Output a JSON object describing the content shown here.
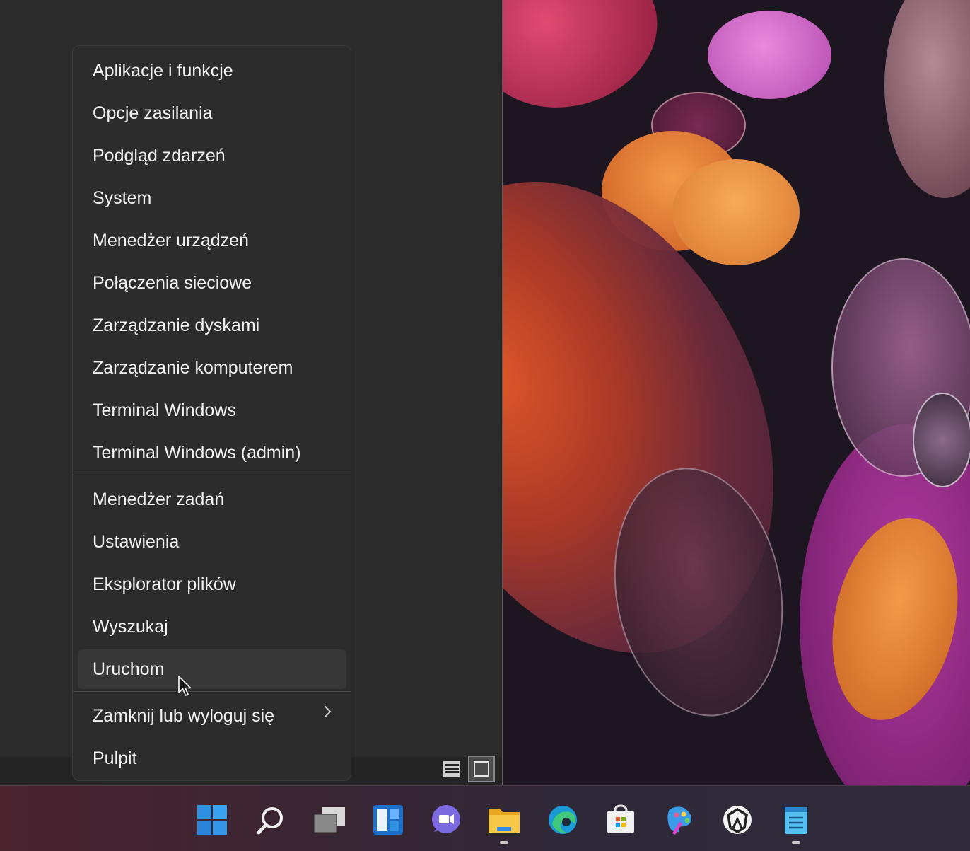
{
  "context_menu": {
    "items": [
      {
        "label": "Aplikacje i funkcje"
      },
      {
        "label": "Opcje zasilania"
      },
      {
        "label": "Podgląd zdarzeń"
      },
      {
        "label": "System"
      },
      {
        "label": "Menedżer urządzeń"
      },
      {
        "label": "Połączenia sieciowe"
      },
      {
        "label": "Zarządzanie dyskami"
      },
      {
        "label": "Zarządzanie komputerem"
      },
      {
        "label": "Terminal Windows"
      },
      {
        "label": "Terminal Windows (admin)"
      },
      {
        "label": "Menedżer zadań"
      },
      {
        "label": "Ustawienia"
      },
      {
        "label": "Eksplorator plików"
      },
      {
        "label": "Wyszukaj"
      },
      {
        "label": "Uruchom",
        "hovered": true
      },
      {
        "label": "Zamknij lub wyloguj się",
        "has_submenu": true
      },
      {
        "label": "Pulpit"
      }
    ]
  },
  "view_toggle": {
    "list_icon": "details-view-icon",
    "tile_icon": "tiles-view-icon",
    "selected": "tiles"
  },
  "taskbar": {
    "icons": [
      {
        "name": "start-icon"
      },
      {
        "name": "search-icon"
      },
      {
        "name": "task-view-icon"
      },
      {
        "name": "widgets-icon"
      },
      {
        "name": "chat-icon"
      },
      {
        "name": "file-explorer-icon",
        "running": true
      },
      {
        "name": "edge-icon"
      },
      {
        "name": "store-icon"
      },
      {
        "name": "paint-icon"
      },
      {
        "name": "app-icon"
      },
      {
        "name": "notepad-icon",
        "running": true
      }
    ]
  },
  "colors": {
    "menu_bg": "#2c2c2c",
    "menu_text": "#f2f2f2",
    "hover_bg": "#373737",
    "accent_blue": "#2f8fe0"
  }
}
